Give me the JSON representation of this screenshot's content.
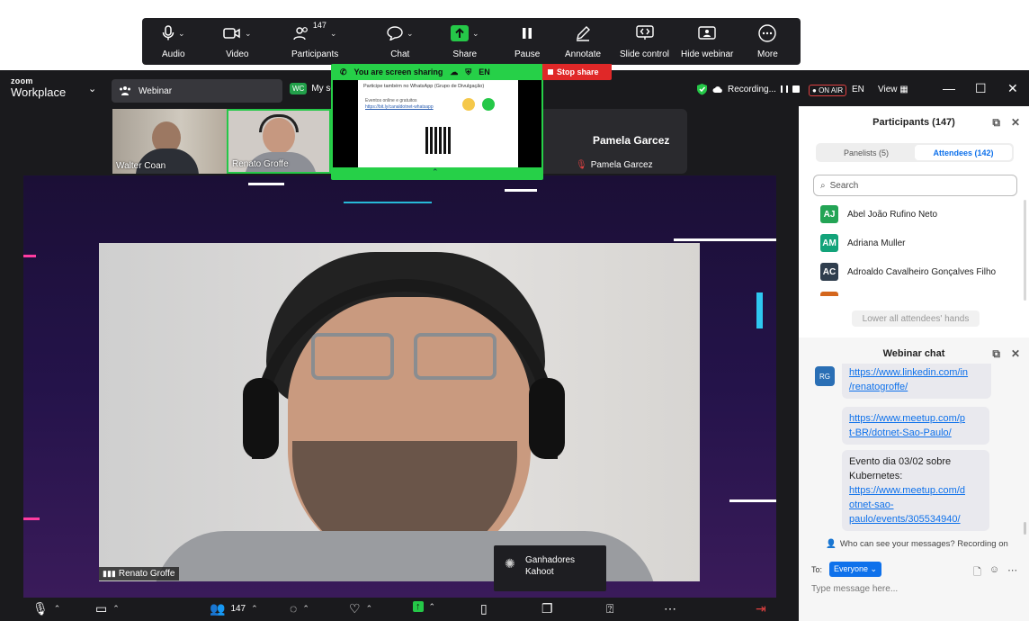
{
  "top_toolbar": {
    "audio": "Audio",
    "video": "Video",
    "participants": "Participants",
    "participants_count": "147",
    "chat": "Chat",
    "share": "Share",
    "pause": "Pause",
    "annotate": "Annotate",
    "slide_control": "Slide control",
    "hide_webinar": "Hide webinar",
    "more": "More"
  },
  "title_bar": {
    "logo_small": "zoom",
    "logo_main": "Workplace",
    "webinar_tab": "Webinar",
    "my_tab_badge": "WC",
    "my_tab_label": "My sc",
    "recording": "Recording...",
    "on_air": "ON AIR",
    "language": "EN",
    "view": "View"
  },
  "screen_share": {
    "status": "You are screen sharing",
    "language": "EN",
    "stop": "Stop share",
    "doc_line1": "Participe também no WhatsApp (Grupo de Divulgação)",
    "doc_line2": "Eventos online e gratuitos",
    "doc_line3": "https://bit.ly/canaldotnet-whatsapp"
  },
  "videos": {
    "thumb1_name": "Walter Coan",
    "thumb2_name": "Renato Groffe",
    "thumb3_title": "Pamela Garcez",
    "thumb3_name": "Pamela Garcez",
    "speaker_name": "Renato Groffe"
  },
  "kahoot": {
    "line1": "Ganhadores",
    "line2": "Kahoot"
  },
  "bottom_bar": {
    "participants_count": "147"
  },
  "participants_panel": {
    "title": "Participants (147)",
    "tab_panelists": "Panelists (5)",
    "tab_attendees": "Attendees (142)",
    "search_placeholder": "Search",
    "attendees": [
      {
        "initials": "AJ",
        "name": "Abel João Rufino Neto",
        "color": "#23a455"
      },
      {
        "initials": "AM",
        "name": "Adriana Muller",
        "color": "#13a37a"
      },
      {
        "initials": "AC",
        "name": "Adroaldo Cavalheiro Gonçalves Filho",
        "color": "#2f3e4e"
      }
    ],
    "lower_hands": "Lower all attendees' hands"
  },
  "chat_panel": {
    "title": "Webinar chat",
    "sender_initials": "RG",
    "msg1": "https://www.linkedin.com/in/renatogroffe/",
    "msg1_a": "https://www.linkedin.com/in",
    "msg1_b": "/renatogroffe/",
    "msg2_a": "https://www.meetup.com/p",
    "msg2_b": "t-BR/dotnet-Sao-Paulo/",
    "msg3_text_a": "Evento dia 03/02 sobre",
    "msg3_text_b": "Kubernetes:",
    "msg3_link_a": "https://www.meetup.com/d",
    "msg3_link_b": "otnet-sao-",
    "msg3_link_c": "paulo/events/305534940/",
    "who_can_see": "Who can see your messages? Recording on",
    "to_label": "To:",
    "to_value": "Everyone",
    "input_placeholder": "Type message here..."
  },
  "colors": {
    "accent": "#0e71eb",
    "share_green": "#26d048",
    "stop_red": "#e02828"
  }
}
